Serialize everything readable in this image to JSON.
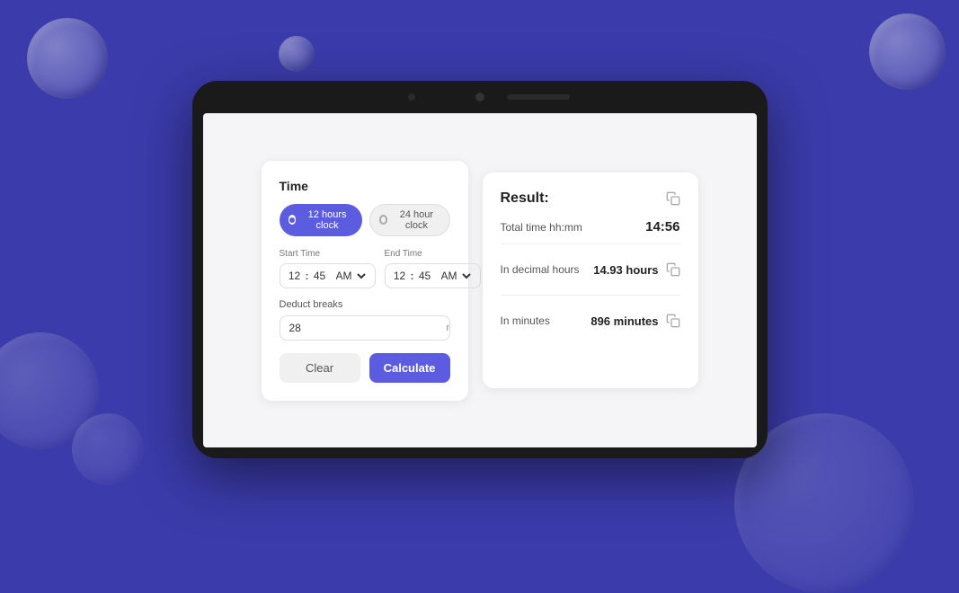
{
  "background": {
    "color": "#3b3bab"
  },
  "left_panel": {
    "title": "Time",
    "clock_options": [
      {
        "label": "12 hours clock",
        "active": true
      },
      {
        "label": "24 hour clock",
        "active": false
      }
    ],
    "start_time": {
      "label": "Start Time",
      "hours": "12",
      "minutes": "45",
      "period": "AM"
    },
    "end_time": {
      "label": "End Time",
      "hours": "12",
      "minutes": "45",
      "period": "AM"
    },
    "deduct_breaks": {
      "label": "Deduct breaks",
      "value": "28",
      "suffix": "minutes"
    },
    "clear_button": "Clear",
    "calculate_button": "Calculate"
  },
  "right_panel": {
    "title": "Result:",
    "total_hhmm": {
      "label": "Total time hh:mm",
      "value": "14:56"
    },
    "decimal_hours": {
      "label": "In decimal hours",
      "value": "14.93 hours"
    },
    "minutes": {
      "label": "In minutes",
      "value": "896 minutes"
    }
  }
}
